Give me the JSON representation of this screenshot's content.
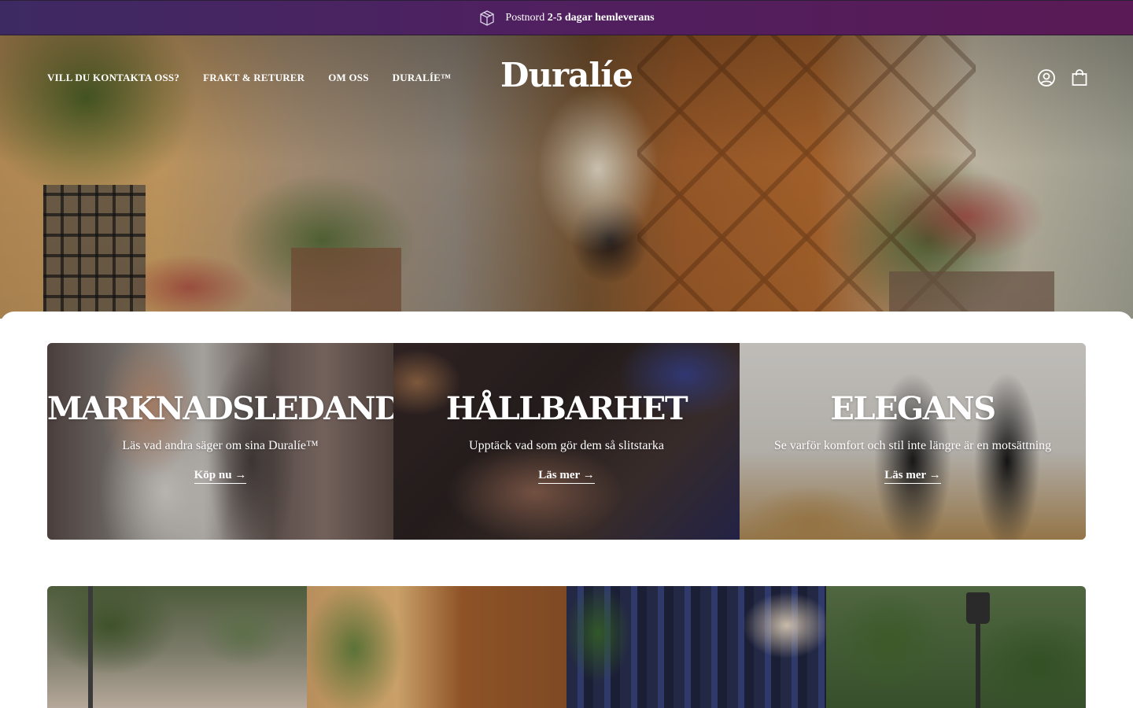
{
  "announcement": {
    "icon": "package-icon",
    "prefix": "Postnord",
    "highlight": "2-5 dagar hemleverans"
  },
  "header": {
    "nav": [
      {
        "label": "VILL DU KONTAKTA OSS?"
      },
      {
        "label": "FRAKT & RETURER"
      },
      {
        "label": "OM OSS"
      },
      {
        "label": "DURALÍE™"
      }
    ],
    "logo": "Duralíe",
    "icons": [
      "account-icon",
      "shopping-bag-icon"
    ]
  },
  "feature_cards": [
    {
      "title": "MARKNADSLEDANDE",
      "subtitle": "Läs vad andra säger om sina Duralíe™",
      "link": "Köp nu",
      "arrow": "→"
    },
    {
      "title": "HÅLLBARHET",
      "subtitle": "Upptäck vad som gör dem så slitstarka",
      "link": "Läs mer",
      "arrow": "→"
    },
    {
      "title": "ELEGANS",
      "subtitle": "Se varför komfort och stil inte längre är en motsättning",
      "link": "Läs mer",
      "arrow": "→"
    }
  ],
  "colors": {
    "announcement_bg": "#4f2060",
    "text_on_image": "#ffffff",
    "panel_bg": "#ffffff"
  }
}
